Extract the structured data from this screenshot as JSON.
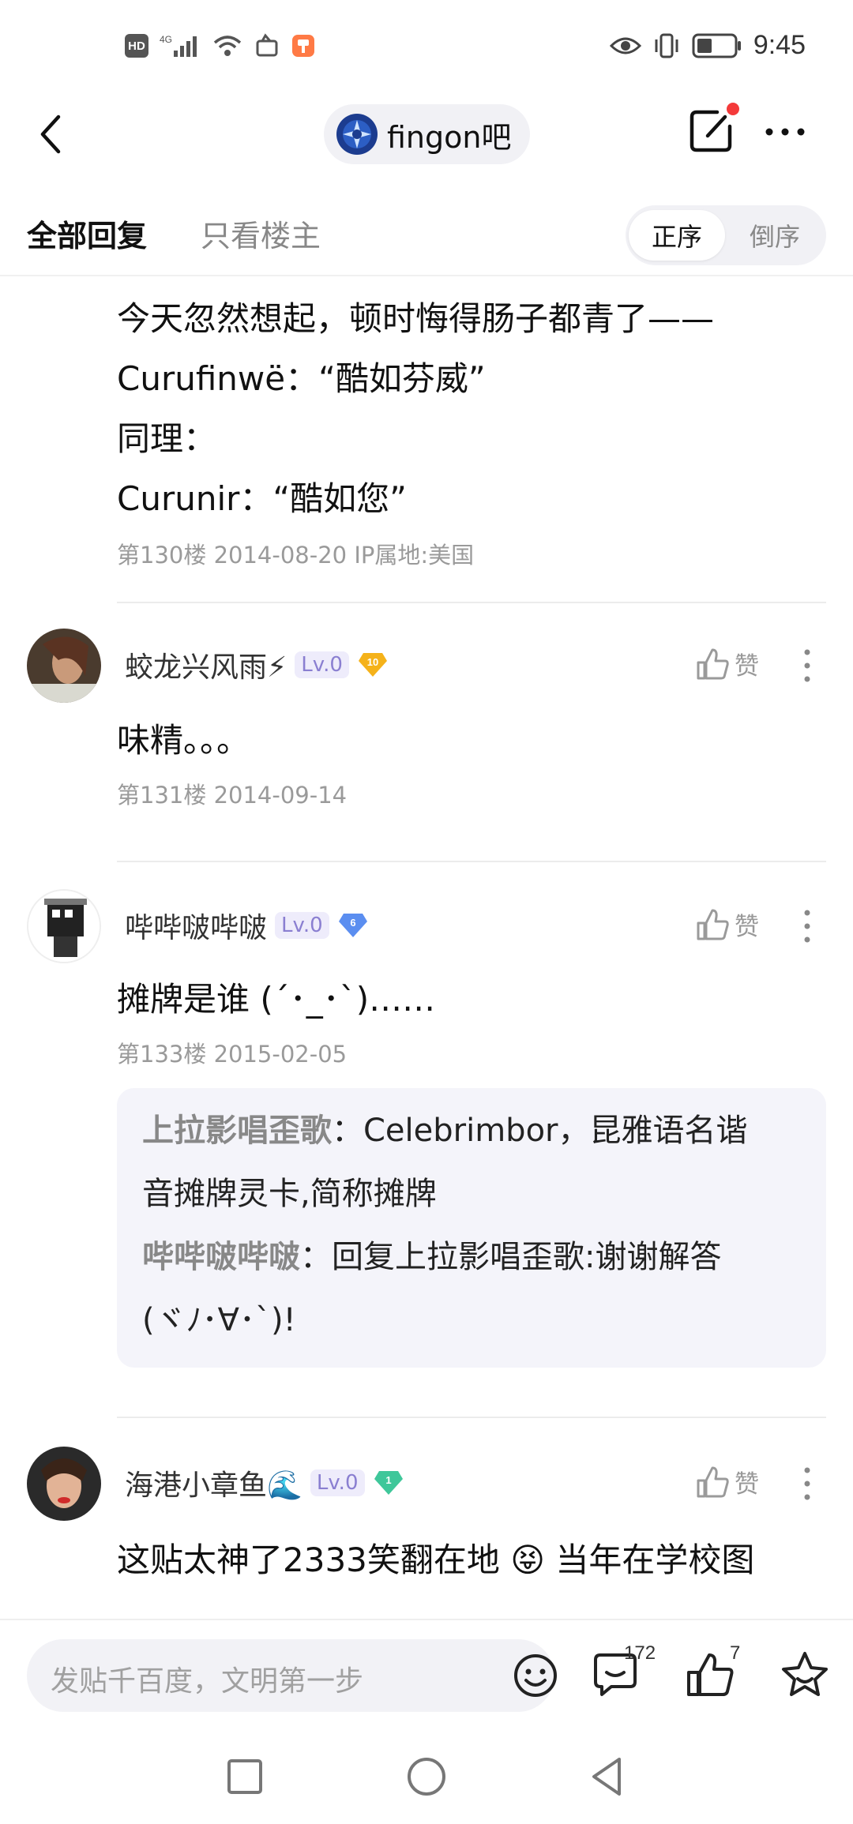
{
  "status_bar": {
    "hd_label": "HD",
    "network": "4G",
    "time": "9:45"
  },
  "header": {
    "forum_name": "fingon吧"
  },
  "tabs": {
    "all_replies": "全部回复",
    "op_only": "只看楼主",
    "sort_asc": "正序",
    "sort_desc": "倒序"
  },
  "post_130": {
    "lines": [
      "今天忽然想起，顿时悔得肠子都青了——",
      "Curufinwë：“酷如芬威”",
      "同理：",
      "Curunir：“酷如您”"
    ],
    "meta": "第130楼  2014-08-20  IP属地:美国"
  },
  "floors": [
    {
      "username": "蛟龙兴风雨⚡",
      "level": "Lv.0",
      "badge": "10",
      "badge_color": "#f5b21a",
      "like_label": "赞",
      "text": "味精。。。",
      "meta": "第131楼  2014-09-14"
    },
    {
      "username": "哔哔啵哔啵",
      "level": "Lv.0",
      "badge": "6",
      "badge_color": "#5b8ef0",
      "like_label": "赞",
      "text": "摊牌是谁 (´･_･`)……",
      "meta": "第133楼  2015-02-05"
    },
    {
      "username": "海港小章鱼🌊",
      "level": "Lv.0",
      "badge": "1",
      "badge_color": "#3fc79a",
      "like_label": "赞",
      "text": "这贴太神了2333笑翻在地 😝 当年在学校图"
    }
  ],
  "replies_133": [
    {
      "author": "上拉影唱歪歌",
      "sep": "：",
      "text_l1": "Celebrimbor，昆雅语名谐",
      "text_l2": "音摊牌灵卡,简称摊牌"
    },
    {
      "author": "哔哔啵哔啵",
      "sep": "：",
      "text_l1": "回复上拉影唱歪歌:谢谢解答",
      "text_l2": "(ヾﾉ･∀･`)!"
    }
  ],
  "bottom_bar": {
    "input_placeholder": "发贴千百度，文明第一步",
    "comment_count": "172",
    "like_count": "7"
  },
  "colors": {
    "accent_red": "#f43a3a",
    "level_tag": "#8a7fd1",
    "reply_bg": "#f4f4fa"
  }
}
